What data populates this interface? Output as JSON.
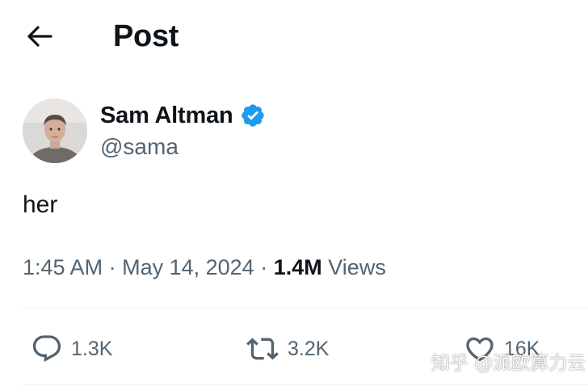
{
  "header": {
    "title": "Post",
    "back_icon": "arrow-left-icon"
  },
  "author": {
    "name": "Sam Altman",
    "handle": "@sama",
    "verified": true,
    "verified_color": "#1d9bf0"
  },
  "post": {
    "text": "her"
  },
  "meta": {
    "time": "1:45 AM",
    "separator": "·",
    "date": "May 14, 2024",
    "views_count": "1.4M",
    "views_label": "Views"
  },
  "actions": {
    "replies": {
      "icon": "reply-icon",
      "count": "1.3K"
    },
    "reposts": {
      "icon": "repost-icon",
      "count": "3.2K"
    },
    "likes": {
      "icon": "heart-icon",
      "count": "16K"
    }
  },
  "watermark": {
    "text": "知乎 @派欧算力云"
  },
  "colors": {
    "text": "#0f1419",
    "secondary": "#536471",
    "divider": "#eff3f4"
  }
}
